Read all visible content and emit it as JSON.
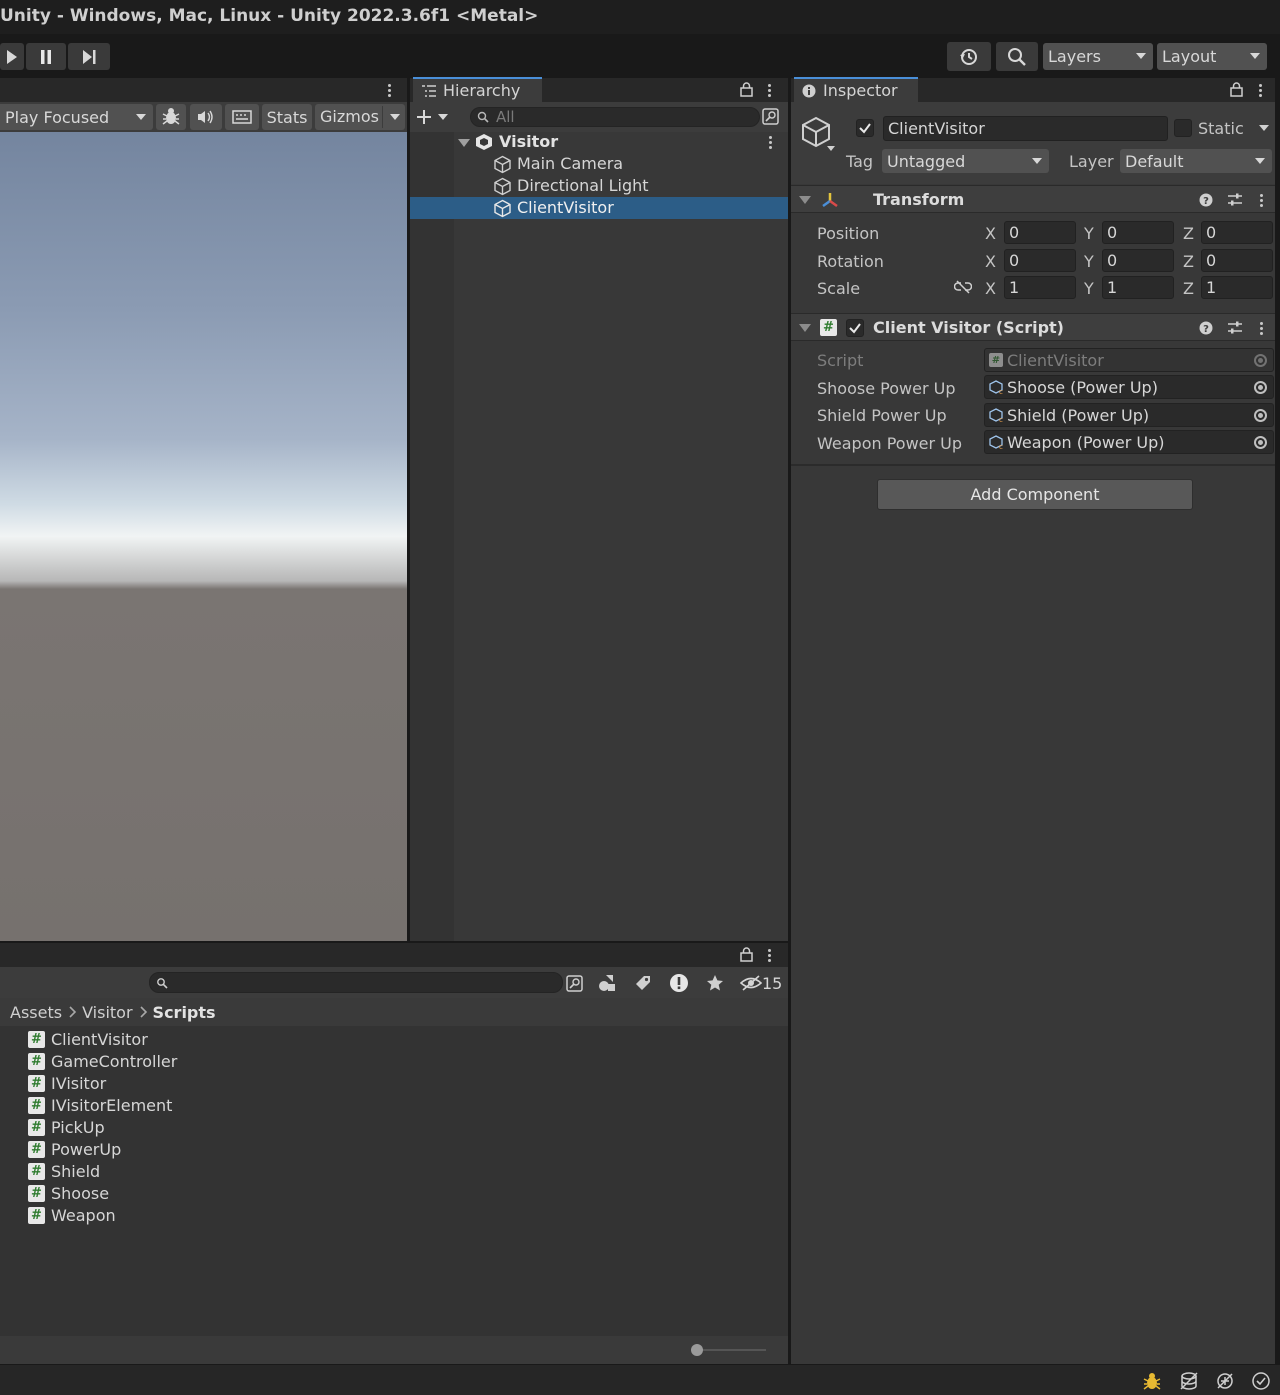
{
  "window": {
    "title": "Unity - Windows, Mac, Linux - Unity 2022.3.6f1 <Metal>"
  },
  "toolbar": {
    "layers_label": "Layers",
    "layout_label": "Layout"
  },
  "game": {
    "play_focused": "Play Focused",
    "stats": "Stats",
    "gizmos": "Gizmos"
  },
  "hierarchy": {
    "tab": "Hierarchy",
    "search_placeholder": "All",
    "scene": "Visitor",
    "items": [
      "Main Camera",
      "Directional Light",
      "ClientVisitor"
    ],
    "selected": "ClientVisitor"
  },
  "inspector": {
    "tab": "Inspector",
    "object_name": "ClientVisitor",
    "static_label": "Static",
    "tag_label": "Tag",
    "tag_value": "Untagged",
    "layer_label": "Layer",
    "layer_value": "Default",
    "transform": {
      "title": "Transform",
      "rows": [
        {
          "label": "Position",
          "x": "0",
          "y": "0",
          "z": "0"
        },
        {
          "label": "Rotation",
          "x": "0",
          "y": "0",
          "z": "0"
        },
        {
          "label": "Scale",
          "x": "1",
          "y": "1",
          "z": "1"
        }
      ],
      "axis_x": "X",
      "axis_y": "Y",
      "axis_z": "Z"
    },
    "script_component": {
      "title": "Client Visitor (Script)",
      "script_label": "Script",
      "script_value": "ClientVisitor",
      "fields": [
        {
          "label": "Shoose Power Up",
          "value": "Shoose (Power Up)"
        },
        {
          "label": "Shield Power Up",
          "value": "Shield (Power Up)"
        },
        {
          "label": "Weapon Power Up",
          "value": "Weapon (Power Up)"
        }
      ]
    },
    "add_component": "Add Component"
  },
  "project": {
    "breadcrumb": [
      "Assets",
      "Visitor",
      "Scripts"
    ],
    "hidden_count": "15",
    "files": [
      "ClientVisitor",
      "GameController",
      "IVisitor",
      "IVisitorElement",
      "PickUp",
      "PowerUp",
      "Shield",
      "Shoose",
      "Weapon"
    ],
    "icon_size": 0.1
  },
  "colors": {
    "accent": "#4a8fd8",
    "selection": "#2c5d87",
    "background": "#383838"
  }
}
